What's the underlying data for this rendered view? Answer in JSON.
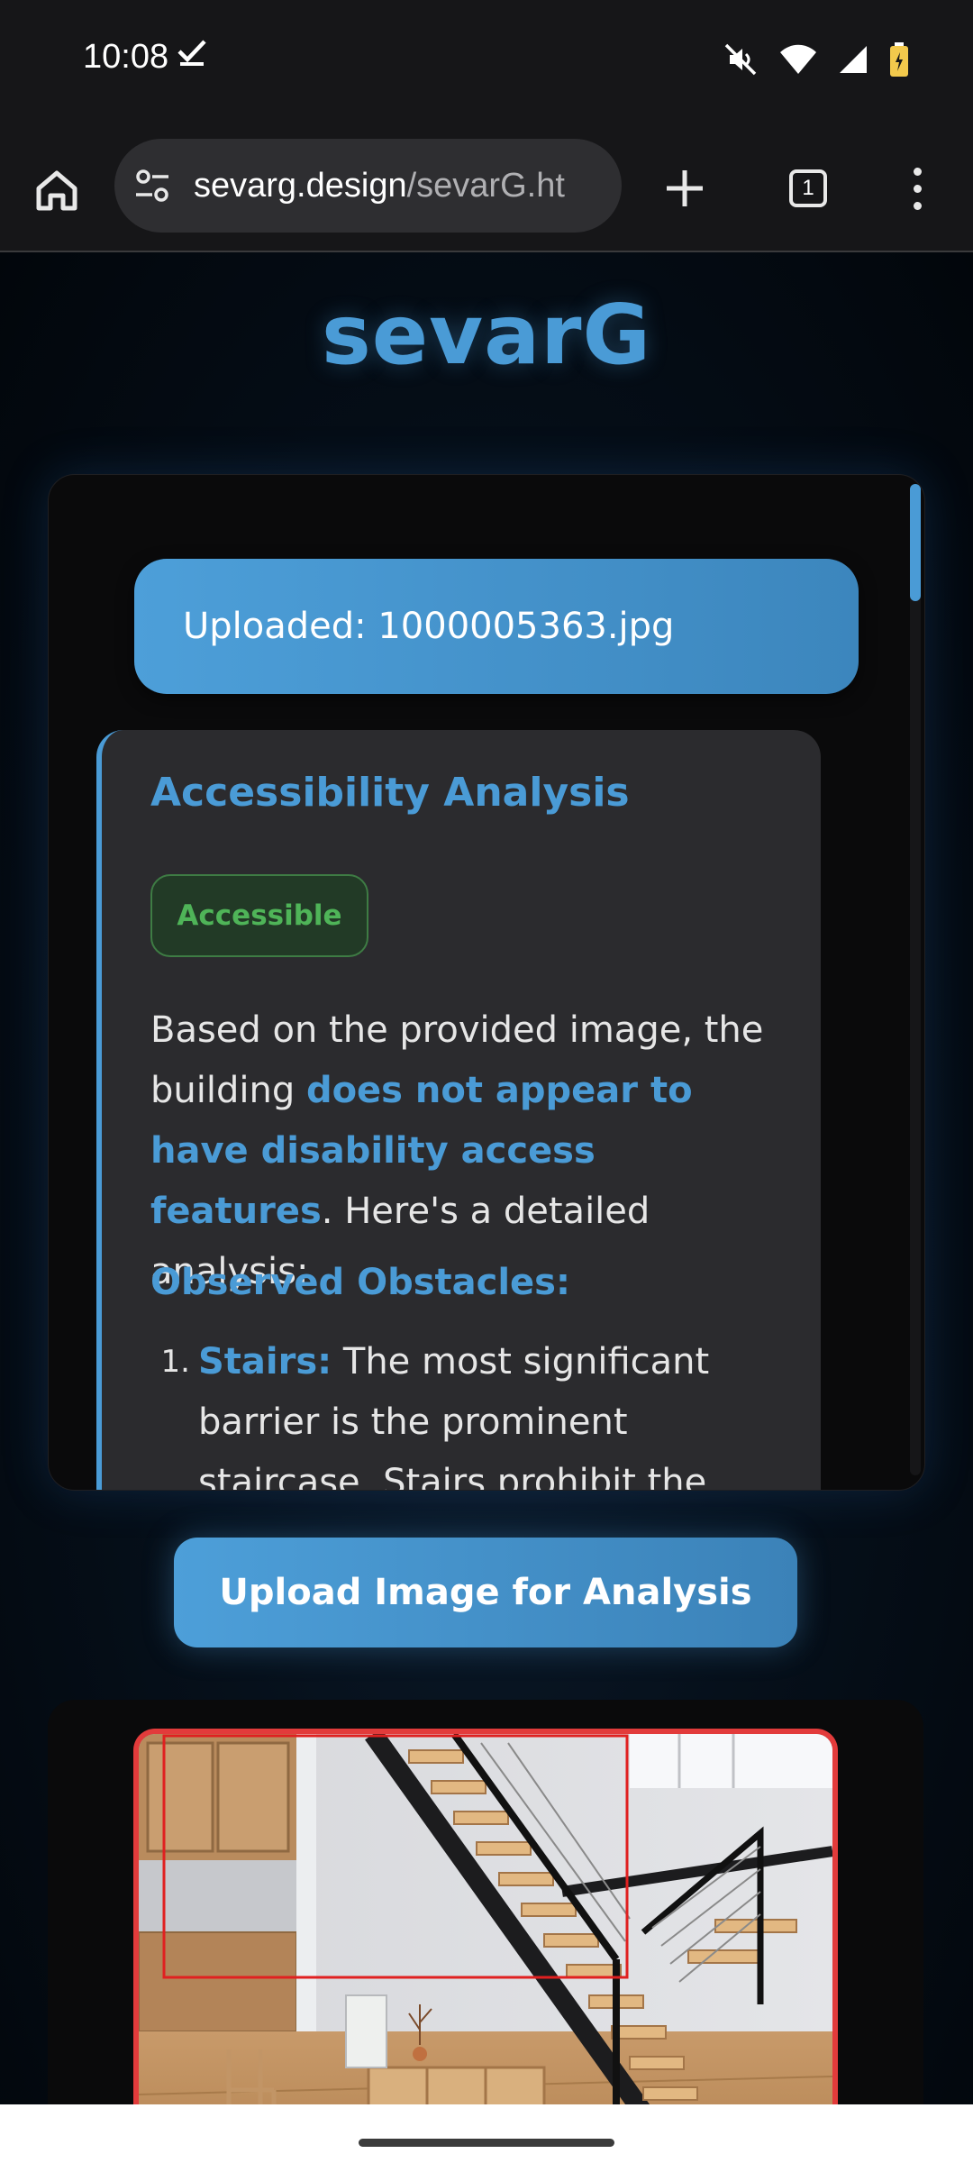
{
  "status_bar": {
    "time": "10:08",
    "icons": [
      "check-icon",
      "mute-icon",
      "wifi-icon",
      "signal-icon",
      "battery-icon"
    ]
  },
  "browser": {
    "url_domain": "sevarg.design",
    "url_path": "/sevarG.ht",
    "tab_count": "1",
    "icons": [
      "home-icon",
      "site-settings-icon",
      "plus-icon",
      "tabs-icon",
      "more-icon"
    ]
  },
  "page": {
    "site_title": "sevarG",
    "upload_message": "Uploaded: 1000005363.jpg",
    "analysis": {
      "title": "Accessibility Analysis",
      "badge": "Accessible",
      "intro_before": "Based on the provided image, the building ",
      "intro_highlight": "does not appear to have disability access features",
      "intro_after": ". Here's a detailed analysis:",
      "obstacles_heading": "Observed Obstacles:",
      "obstacles": [
        {
          "number": "1.",
          "label": "Stairs:",
          "text": " The most significant barrier is the prominent staircase. Stairs prohibit the"
        }
      ]
    },
    "upload_button": "Upload Image for Analysis"
  },
  "colors": {
    "accent": "#4a9bd6",
    "badge_green": "#4fb458",
    "detection_red": "#e23b3b"
  }
}
